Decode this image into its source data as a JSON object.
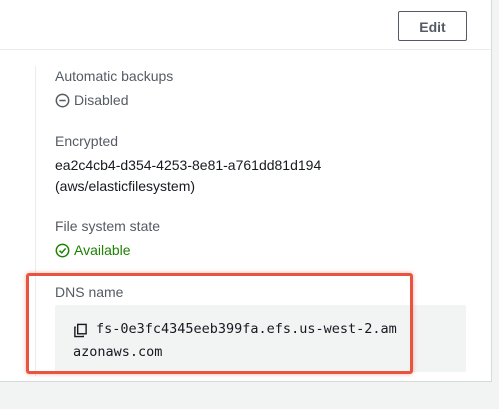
{
  "header": {
    "edit_label": "Edit"
  },
  "fields": {
    "automatic_backups": {
      "label": "Automatic backups",
      "value": "Disabled",
      "icon": "minus-circle-icon"
    },
    "encrypted": {
      "label": "Encrypted",
      "key_id": "ea2c4cb4-d354-4253-8e81-a761dd81d194",
      "key_alias": "(aws/elasticfilesystem)"
    },
    "file_system_state": {
      "label": "File system state",
      "value": "Available",
      "icon": "check-circle-icon"
    },
    "dns_name": {
      "label": "DNS name",
      "value": "fs-0e3fc4345eeb399fa.efs.us-west-2.amazonaws.com",
      "icon": "copy-icon"
    }
  },
  "colors": {
    "available": "#1d8102",
    "disabled": "#545b64",
    "highlight": "#e8543f"
  }
}
